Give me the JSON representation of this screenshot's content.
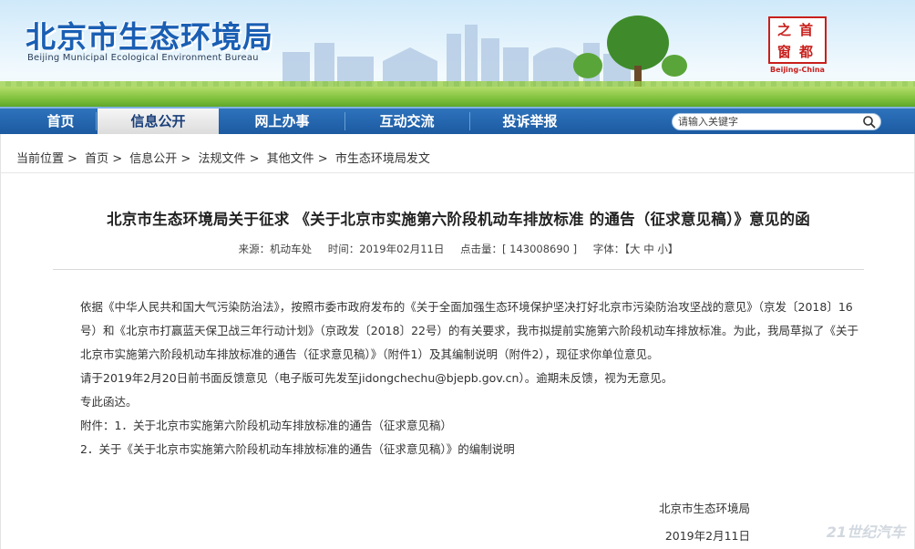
{
  "header": {
    "title": "北京市生态环境局",
    "subtitle": "Beijing Municipal Ecological Environment Bureau",
    "seal_chars": [
      "首",
      "都",
      "之",
      "窗"
    ],
    "seal_caption": "Beijing-China"
  },
  "nav": {
    "items": [
      {
        "label": "首页",
        "active": false
      },
      {
        "label": "信息公开",
        "active": true
      },
      {
        "label": "网上办事",
        "active": false
      },
      {
        "label": "互动交流",
        "active": false
      },
      {
        "label": "投诉举报",
        "active": false
      }
    ],
    "search_placeholder": "请输入关键字"
  },
  "breadcrumb": {
    "prefix": "当前位置",
    "items": [
      "首页",
      "信息公开",
      "法规文件",
      "其他文件",
      "市生态环境局发文"
    ]
  },
  "article": {
    "title": "北京市生态环境局关于征求 《关于北京市实施第六阶段机动车排放标准 的通告（征求意见稿）》意见的函",
    "source": "来源：机动车处",
    "time": "时间：2019年02月11日",
    "clicks": "点击量：[ 143008690 ]",
    "font_label": "字体：",
    "font_sizes": "【大 中 小】",
    "paragraphs": [
      "依据《中华人民共和国大气污染防治法》，按照市委市政府发布的《关于全面加强生态环境保护坚决打好北京市污染防治攻坚战的意见》（京发〔2018〕16号）和《北京市打赢蓝天保卫战三年行动计划》（京政发〔2018〕22号）的有关要求，我市拟提前实施第六阶段机动车排放标准。为此，我局草拟了《关于北京市实施第六阶段机动车排放标准的通告（征求意见稿）》（附件1）及其编制说明（附件2），现征求你单位意见。",
      "请于2019年2月20日前书面反馈意见（电子版可先发至jidongchechu@bjepb.gov.cn）。逾期未反馈，视为无意见。",
      "专此函达。",
      "附件：1．关于北京市实施第六阶段机动车排放标准的通告（征求意见稿）",
      "2．关于《关于北京市实施第六阶段机动车排放标准的通告（征求意见稿）》的编制说明"
    ],
    "signature": "北京市生态环境局",
    "date": "2019年2月11日"
  },
  "watermark": "21世纪汽车",
  "colors": {
    "nav_bg": "#1c5aa1",
    "title_blue": "#1a5fb4",
    "seal_red": "#c8201c"
  }
}
